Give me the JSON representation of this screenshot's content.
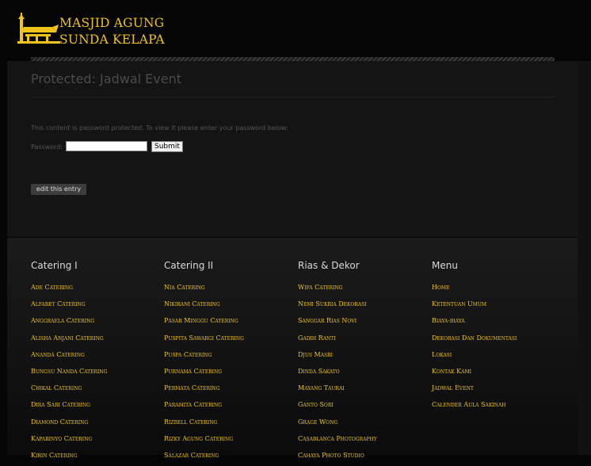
{
  "brand": {
    "line1": "MASJID AGUNG",
    "line2": "SUNDA KELAPA",
    "color": "#f0c419"
  },
  "post": {
    "title": "Protected: Jadwal Event",
    "notice": "This content is password protected. To view it please enter your password below:",
    "password_label": "Password:",
    "password_value": "",
    "submit_label": "Submit",
    "edit_label": "edit this entry"
  },
  "footer": {
    "columns": [
      {
        "title": "Catering I",
        "links": [
          "Ade Catering",
          "Alfabet Catering",
          "Anggraela Catering",
          "Alisha Anjani Catering",
          "Ananda Catering",
          "Bungsu Nanda Catering",
          "Chikal Catering",
          "Dira Sari Catering",
          "Diamond Catering",
          "Kaparinyo Catering",
          "Kirin Catering"
        ]
      },
      {
        "title": "Catering II",
        "links": [
          "Nia Catering",
          "Nikirani Catering",
          "Pasar Minggu Catering",
          "Puspita Sawargi Catering",
          "Puspa Catering",
          "Purnama Catering",
          "Permata Catering",
          "Paramita Catering",
          "Rizbell Catering",
          "Rizky Agung Catering",
          "Salazar Catering"
        ]
      },
      {
        "title": "Rias & Dekor",
        "links": [
          "Wifa Catering",
          "Nemi Sukria Dekorasi",
          "Sanggar Rias Novi",
          "Gadih Ranti",
          "Djus Masri",
          "Dinda Sakato",
          "Mayang Taurai",
          "Ganto Sori",
          "Grage Wong",
          "Casablanca Photography",
          "Cahaya Photo Studio"
        ]
      },
      {
        "title": "Menu",
        "links": [
          "Home",
          "Ketentuan Umum",
          "Biaya-biaya",
          "Dekorasi Dan Dokumentasi",
          "Lokasi",
          "Kontak Kami",
          "Jadwal Event",
          "Calender Aula Sakinah"
        ]
      }
    ]
  }
}
